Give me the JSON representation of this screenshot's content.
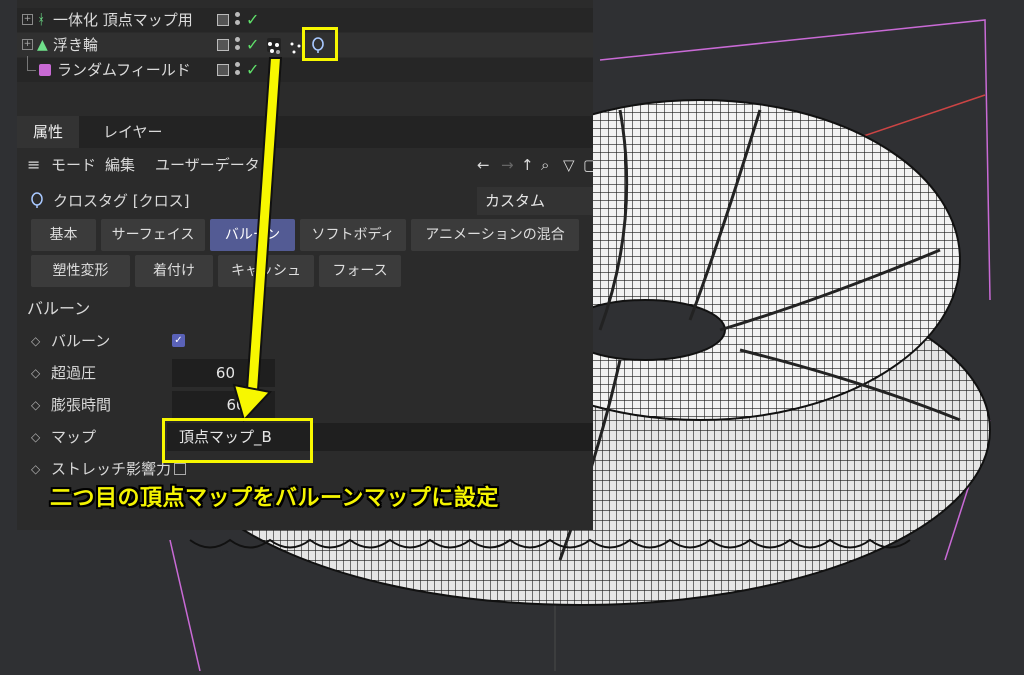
{
  "object_manager": {
    "rows": [
      {
        "label": "一体化 頂点マップ用",
        "icon": "figure-icon"
      },
      {
        "label": "浮き輪",
        "icon": "triangle-object-icon"
      },
      {
        "label": "ランダムフィールド",
        "icon": "dice-icon"
      }
    ]
  },
  "tabs": [
    "属性",
    "レイヤー"
  ],
  "menu": {
    "items": [
      "モード",
      "編集",
      "ユーザーデータ"
    ]
  },
  "tag": {
    "title": "クロスタグ [クロス]",
    "preset": "カスタム"
  },
  "buttons": {
    "row1": [
      "基本",
      "サーフェイス",
      "バルーン",
      "ソフトボディ",
      "アニメーションの混合"
    ],
    "row2": [
      "塑性変形",
      "着付け",
      "キャッシュ",
      "フォース"
    ]
  },
  "section": {
    "title": "バルーン"
  },
  "params": {
    "balloon_label": "バルーン",
    "overpressure_label": "超過圧",
    "overpressure_value": "60",
    "inflate_time_label": "膨張時間",
    "inflate_time_value": "60 F",
    "map_label": "マップ",
    "map_value": "頂点マップ_B",
    "stretch_label": "ストレッチ影響力"
  },
  "caption": "二つ目の頂点マップをバルーンマップに設定",
  "colors": {
    "accent": "#535b94",
    "highlight": "#f7f700",
    "check": "#5fe06a"
  }
}
